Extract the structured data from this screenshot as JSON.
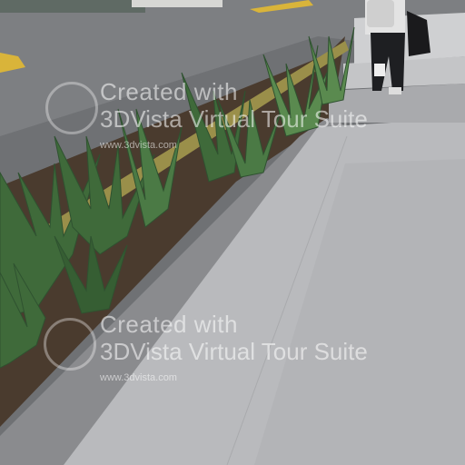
{
  "watermark_top": {
    "line1": "Created with",
    "line2": "3DVista Virtual Tour Suite",
    "url": "www.3dvista.com"
  },
  "watermark_bottom": {
    "line1": "Created with",
    "line2": "3DVista Virtual Tour Suite",
    "url": "www.3dvista.com"
  },
  "colors": {
    "asphalt": "#6f7174",
    "walkway": "#b9babd",
    "curb": "#8a8b8e",
    "soil": "#4a3b2e",
    "plant": "#3f6a3a",
    "curb_paint": "#d9b43a"
  }
}
